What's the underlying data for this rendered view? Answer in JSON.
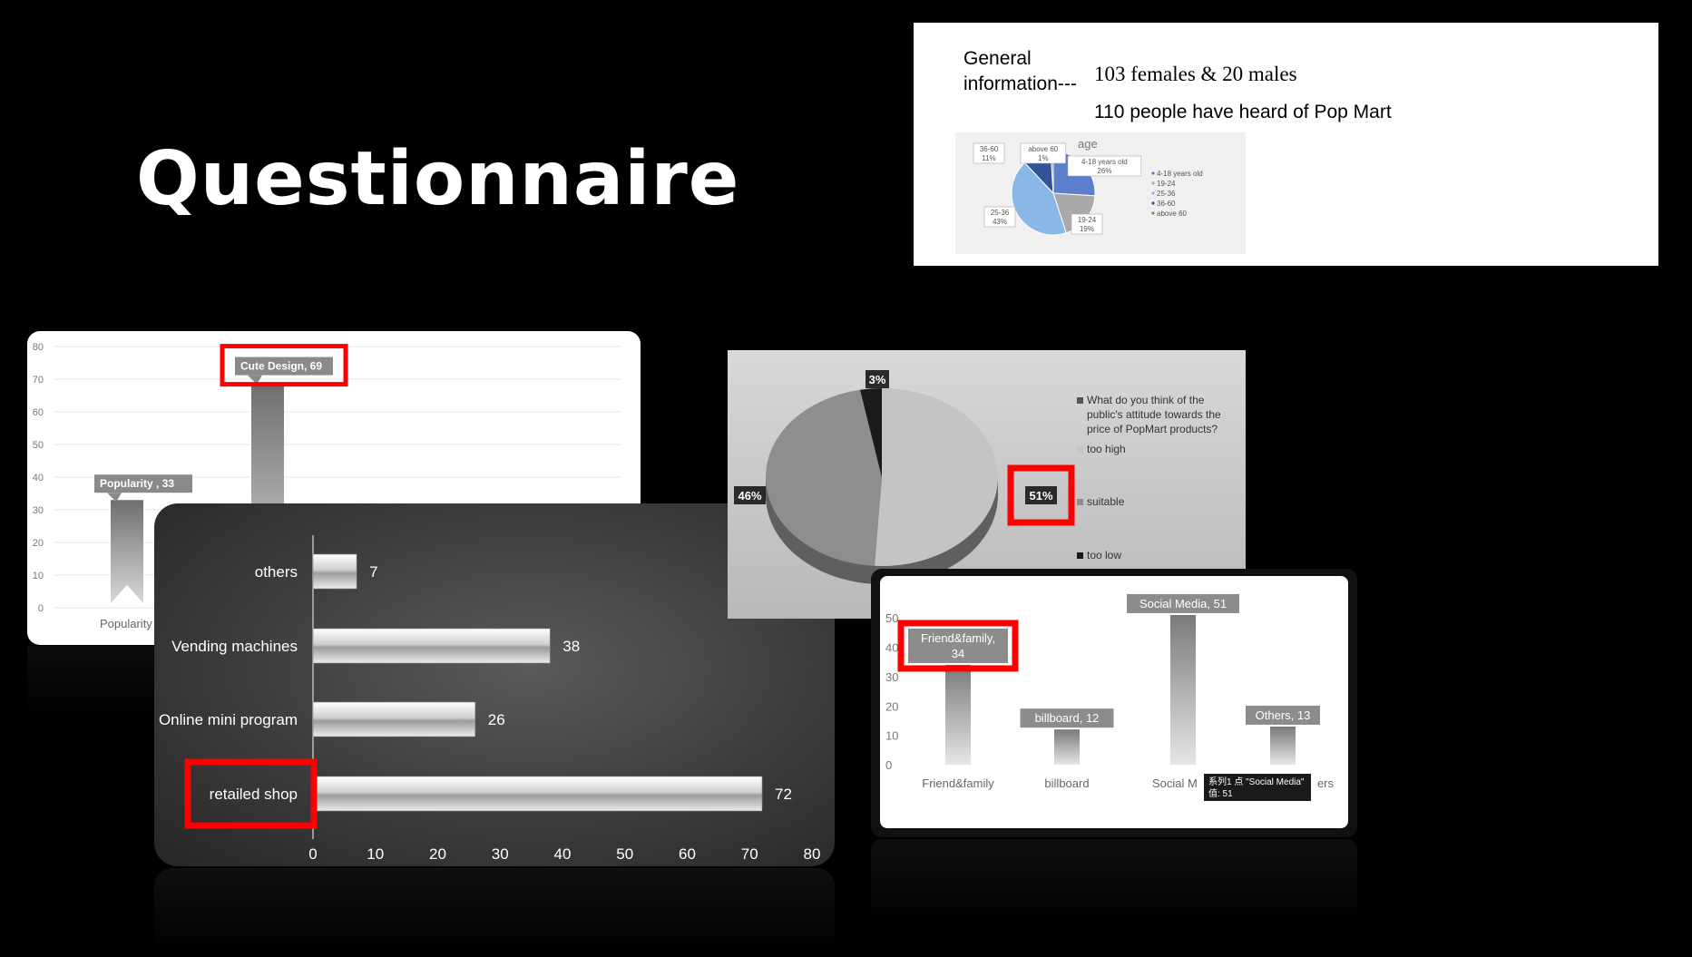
{
  "title": "Questionnaire",
  "info": {
    "label_line1": "General",
    "label_line2": "information---",
    "line1": "103 females & 20 males",
    "line2": "110 people have heard of Pop Mart"
  },
  "colors": {
    "highlight": "#ff0000",
    "background": "#000000"
  },
  "chart_data": [
    {
      "id": "age",
      "type": "pie",
      "title": "age",
      "slices": [
        {
          "label": "4-18 years old",
          "value": 26,
          "color": "#5b7fcc"
        },
        {
          "label": "19-24",
          "value": 19,
          "color": "#a9a9a9"
        },
        {
          "label": "25-36",
          "value": 43,
          "color": "#8ab8e6"
        },
        {
          "label": "36-60",
          "value": 11,
          "color": "#2f5597"
        },
        {
          "label": "above 60",
          "value": 1,
          "color": "#7f7f7f"
        }
      ],
      "data_labels": [
        {
          "line1": "4-18 years old",
          "line2": "26%"
        },
        {
          "line1": "19-24",
          "line2": "19%"
        },
        {
          "line1": "25-36",
          "line2": "43%"
        },
        {
          "line1": "36-60",
          "line2": "11%"
        },
        {
          "line1": "above 60",
          "line2": "1%"
        }
      ],
      "legend": [
        "4-18 years old",
        "19-24",
        "25-36",
        "36-60",
        "above 60"
      ],
      "legend_position": "right"
    },
    {
      "id": "preference",
      "type": "bar",
      "categories": [
        "Popularity",
        "Cute Design"
      ],
      "values": [
        33,
        69
      ],
      "data_labels": [
        "Popularity , 33",
        "Cute Design, 69"
      ],
      "y_ticks": [
        "0",
        "10",
        "20",
        "30",
        "40",
        "50",
        "60",
        "70",
        "80"
      ],
      "ylim": [
        0,
        80
      ],
      "grid": true,
      "highlight": "Cute Design"
    },
    {
      "id": "channels",
      "type": "bar",
      "orientation": "horizontal",
      "categories": [
        "others",
        "Vending machines",
        "Online mini program",
        "retailed shop"
      ],
      "values": [
        7,
        38,
        26,
        72
      ],
      "x_ticks": [
        "0",
        "10",
        "20",
        "30",
        "40",
        "50",
        "60",
        "70",
        "80"
      ],
      "xlim": [
        0,
        80
      ],
      "highlight": "retailed shop"
    },
    {
      "id": "price",
      "type": "pie",
      "legend_title": "What do you think of the public's attitude towards the price of PopMart products?",
      "legend_title_lines": [
        "What do you think of the",
        "public's attitude towards the",
        "price of PopMart products?"
      ],
      "slices": [
        {
          "label": "too high",
          "value": 51,
          "pct": "51%",
          "color": "#c4c4c4"
        },
        {
          "label": "suitable",
          "value": 46,
          "pct": "46%",
          "color": "#8e8e8e"
        },
        {
          "label": "too low",
          "value": 3,
          "pct": "3%",
          "color": "#1a1a1a"
        }
      ],
      "legend_position": "right",
      "highlight": "too high"
    },
    {
      "id": "source",
      "type": "bar",
      "categories": [
        "Friend&family",
        "billboard",
        "Social Media",
        "Others"
      ],
      "values": [
        34,
        12,
        51,
        13
      ],
      "data_labels": [
        {
          "line1": "Friend&family,",
          "line2": "34"
        },
        {
          "line1": "billboard, 12",
          "line2": ""
        },
        {
          "line1": "Social Media, 51",
          "line2": ""
        },
        {
          "line1": "Others, 13",
          "line2": ""
        }
      ],
      "x_labels_visible": [
        "Friend&family",
        "billboard",
        "Social M",
        "ers"
      ],
      "y_ticks": [
        "0",
        "10",
        "20",
        "30",
        "40",
        "50"
      ],
      "ylim": [
        0,
        55
      ],
      "tooltip": {
        "line1": "系列1 点 \"Social Media\"",
        "line2": "值: 51"
      },
      "highlight": "Friend&family"
    }
  ]
}
